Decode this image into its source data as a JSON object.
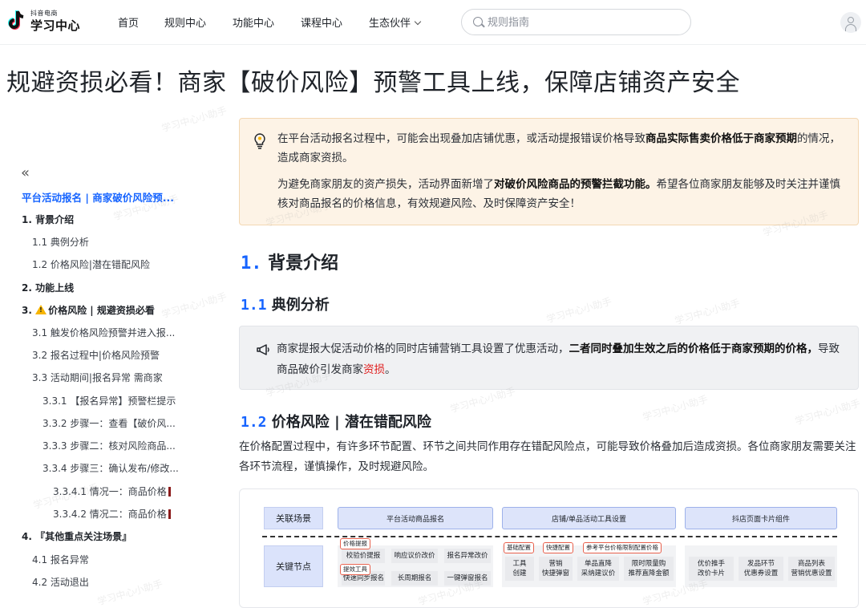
{
  "header": {
    "logo_sub": "抖音电商",
    "logo_main": "学习中心",
    "nav": [
      "首页",
      "规则中心",
      "功能中心",
      "课程中心",
      "生态伙伴"
    ],
    "search_placeholder": "规则指南"
  },
  "article": {
    "title": "规避资损必看！商家【破价风险】预警工具上线，保障店铺资产安全"
  },
  "sidebar": {
    "collapse_glyph": "«",
    "active_title": "平台活动报名 | 商家破价风险预...",
    "items": [
      {
        "label": "1. 背景介绍",
        "bold": true
      },
      {
        "label": "1.1 典例分析"
      },
      {
        "label": "1.2 价格风险|潜在错配风险"
      },
      {
        "label": "2. 功能上线",
        "bold": true
      },
      {
        "label": "价格风险 | 规避资损必看",
        "prefix": "3.",
        "bold": true
      },
      {
        "label": "3.1 触发价格风险预警并进入报..."
      },
      {
        "label": "3.2 报名过程中|价格风险预警"
      },
      {
        "label": "3.3 活动期间|报名异常 需商家"
      },
      {
        "label": "3.3.1 【报名异常】预警栏提示"
      },
      {
        "label": "3.3.2 步骤一：查看【破价风..."
      },
      {
        "label": "3.3.3 步骤二：核对风险商品..."
      },
      {
        "label": "3.3.4 步骤三：确认发布/修改..."
      },
      {
        "label": "3.3.4.1 情况一：商品价格"
      },
      {
        "label": "3.3.4.2 情况二：商品价格"
      },
      {
        "label": "4. 『其他重点关注场景』",
        "bold": true
      },
      {
        "label": "4.1 报名异常"
      },
      {
        "label": "4.2 活动退出"
      }
    ]
  },
  "tip": {
    "p1_a": "在平台活动报名过程中，可能会出现叠加店铺优惠，或活动提报错误价格导致",
    "p1_b": "商品实际售卖价格低于商家预期",
    "p1_c": "的情况，造成商家资损。",
    "p2_a": "为避免商家朋友的资产损失，活动界面新增了",
    "p2_b": "对破价风险商品的预警拦截功能。",
    "p2_c": "希望各位商家朋友能够及时关注并谨慎核对商品报名的价格信息，有效规避风险、及时保障资产安全！"
  },
  "section1": {
    "num": "1.",
    "title": "背景介绍"
  },
  "section11": {
    "num": "1.1",
    "title": "典例分析"
  },
  "note": {
    "a": "商家提报大促活动价格的同时店铺营销工具设置了优惠活动，",
    "b": "二者同时叠加生效之后的价格低于商家预期的价格，",
    "c": "导致商品破价引发商家",
    "d": "资损",
    "e": "。"
  },
  "section12": {
    "num": "1.2",
    "title": "价格风险 | 潜在错配风险"
  },
  "paragraph": "在价格配置过程中，有许多环节配置、环节之间共同作用存在错配风险点，可能导致价格叠加后造成资损。各位商家朋友需要关注各环节流程，谨慎操作，及时规避风险。",
  "diagram": {
    "row1_label": "关联场景",
    "row2_label": "关键节点",
    "scenes": [
      "平台活动商品报名",
      "店铺/单品活动工具设置",
      "抖店页面卡片组件"
    ],
    "nodes": {
      "a1": "校验价提报",
      "a2": "响应议价改价",
      "a3": "报名异常改价",
      "a4": "快速同步报名",
      "a5": "长周期报名",
      "a6": "一键弹窗报名",
      "b1": "工具\n创建",
      "b2": "营销\n快捷弹窗",
      "b3": "单品直降\n采纳建议价",
      "b4": "限时限量购\n推荐直降金额",
      "c1": "优价推手\n改价卡片",
      "c2": "发品环节\n优惠券设置",
      "c3": "商品列表\n营销优惠设置"
    },
    "tags": {
      "t1": "价格提报",
      "t2": "提效工具",
      "t3": "基础配置",
      "t4": "快捷配置",
      "t5": "参考平台价格限制配置价格"
    }
  },
  "watermark": "学习中心小助手",
  "colors": {
    "accent": "#1664ff",
    "tip_bg": "#fdf3e6",
    "note_bg": "#f0f1f3",
    "risk_red": "#e02020"
  }
}
